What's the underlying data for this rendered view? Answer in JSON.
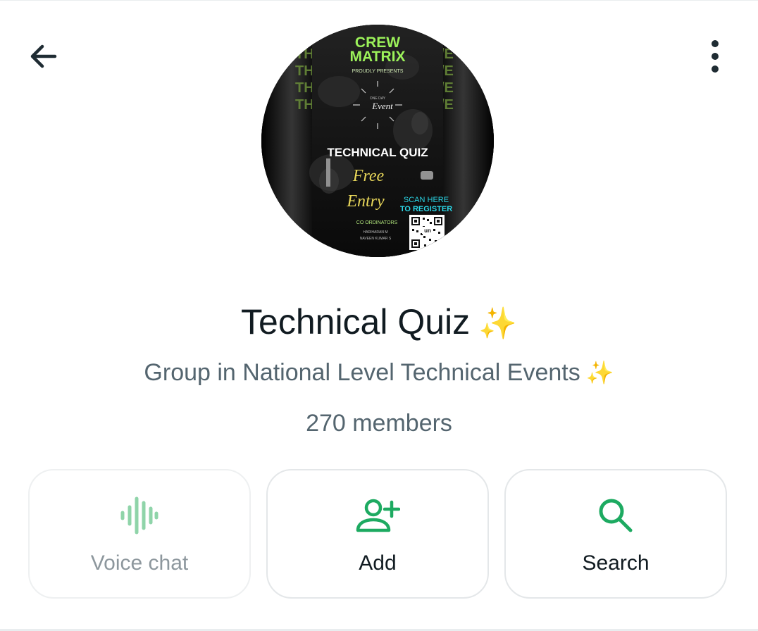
{
  "header": {
    "back_icon": "arrow-left-icon",
    "menu_icon": "more-vertical-icon"
  },
  "avatar": {
    "poster": {
      "line1": "CREW",
      "line2": "MATRIX",
      "presents": "PROUDLY PRESENTS",
      "event_small": "ONE DAY",
      "event": "Event",
      "quiz": "TECHNICAL QUIZ",
      "free": "Free",
      "entry": "Entry",
      "scan": "SCAN HERE",
      "register": "TO REGISTER",
      "coordinators": "CO ORDINATORS",
      "name1": "HARIHARAN M",
      "name2": "NAVEEN KUMAR S",
      "side_left": [
        "TH",
        "TH",
        "TH",
        "TH"
      ],
      "side_right": [
        "/E",
        "/E",
        "/E",
        "/E"
      ]
    }
  },
  "group": {
    "title": "Technical Quiz",
    "title_emoji": "✨",
    "subtitle": "Group in National Level Technical Events",
    "subtitle_emoji": "✨",
    "members": "270 members"
  },
  "actions": [
    {
      "label": "Voice chat",
      "icon": "voice-wave-icon",
      "enabled": false
    },
    {
      "label": "Add",
      "icon": "add-person-icon",
      "enabled": true
    },
    {
      "label": "Search",
      "icon": "search-icon",
      "enabled": true
    }
  ],
  "colors": {
    "accent": "#1daa61",
    "accent_disabled": "#8fd4a9",
    "text_primary": "#111b21",
    "text_secondary": "#54656f",
    "neon_green": "#9cf25a",
    "poster_cyan": "#2bd6e6"
  }
}
